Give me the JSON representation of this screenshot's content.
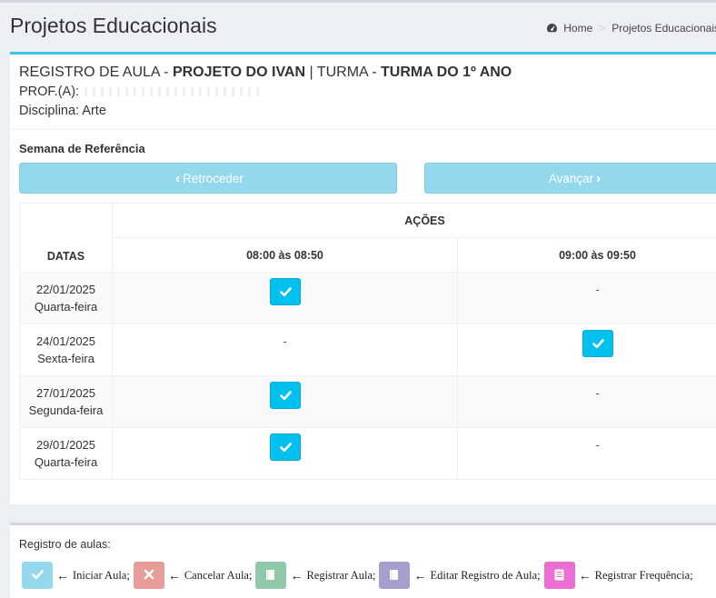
{
  "header": {
    "title": "Projetos Educacionais",
    "breadcrumb": [
      "Home",
      "Projetos Educacionais"
    ]
  },
  "registro": {
    "prefix": "REGISTRO DE AULA - ",
    "projeto": "PROJETO DO IVAN",
    "turma_prefix": " | TURMA - ",
    "turma": "TURMA DO 1º ANO",
    "prof_label": "PROF.(A):",
    "disciplina": "Disciplina: Arte"
  },
  "semana": {
    "label": "Semana de Referência",
    "prev_label": "Retroceder",
    "next_label": "Avançar"
  },
  "table": {
    "acoes_header": "AÇÕES",
    "datas_header": "DATAS",
    "slots": [
      "08:00 às 08:50",
      "09:00 às 09:50"
    ],
    "rows": [
      {
        "date": "22/01/2025",
        "weekday": "Quarta-feira",
        "slot1": "check",
        "slot2": "-"
      },
      {
        "date": "24/01/2025",
        "weekday": "Sexta-feira",
        "slot1": "-",
        "slot2": "check"
      },
      {
        "date": "27/01/2025",
        "weekday": "Segunda-feira",
        "slot1": "check",
        "slot2": "-"
      },
      {
        "date": "29/01/2025",
        "weekday": "Quarta-feira",
        "slot1": "check",
        "slot2": "-"
      }
    ]
  },
  "legend": {
    "title": "Registro de aulas:",
    "items": [
      {
        "label": "Iniciar Aula;",
        "color": "#93d8ec",
        "icon": "check-icon"
      },
      {
        "label": "Cancelar Aula;",
        "color": "#e89c98",
        "icon": "times-icon"
      },
      {
        "label": "Registrar Aula;",
        "color": "#8fc9a9",
        "icon": "book-icon"
      },
      {
        "label": "Editar Registro de Aula;",
        "color": "#a79ed0",
        "icon": "book-icon"
      },
      {
        "label": "Registrar Frequência;",
        "color": "#ec6ed2",
        "icon": "list-icon"
      }
    ]
  },
  "colors": {
    "accent": "#3fc4e6",
    "check_button": "#00c0ef"
  }
}
